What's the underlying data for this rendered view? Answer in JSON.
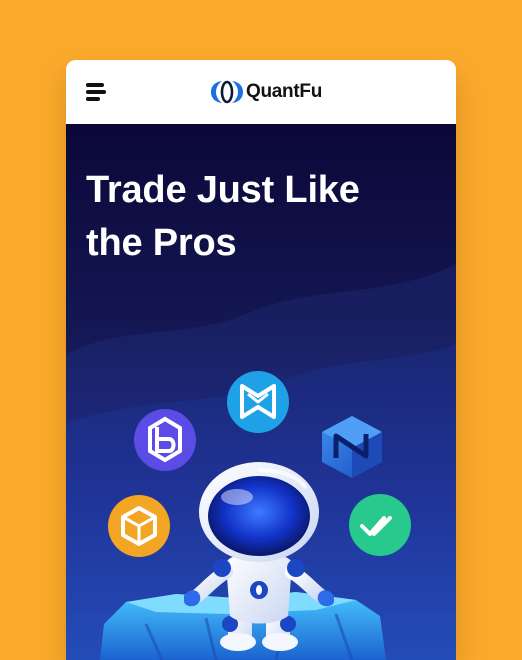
{
  "colors": {
    "page_background": "#FBAB2C",
    "header_background": "#FFFFFF",
    "hero_gradient_top": "#0B0838",
    "hero_gradient_bottom": "#2453C4",
    "token_purple": "#5B4CE6",
    "token_blue": "#1FA1E8",
    "token_navy_cube": "#2F6BE0",
    "token_orange": "#F2A624",
    "token_green": "#27C98D"
  },
  "header": {
    "menu_icon": "hamburger-menu-icon",
    "logo_icon": "quantfu-logo-mark",
    "logo_text": "QuantFu"
  },
  "hero": {
    "title": "Trade Just Like the Pros",
    "illustration": "astronaut-robot-with-crypto-tokens",
    "tokens": [
      "token-b-icon",
      "token-m-icon",
      "token-n-cube-icon",
      "token-orange-cube-icon",
      "token-check-icon"
    ]
  }
}
